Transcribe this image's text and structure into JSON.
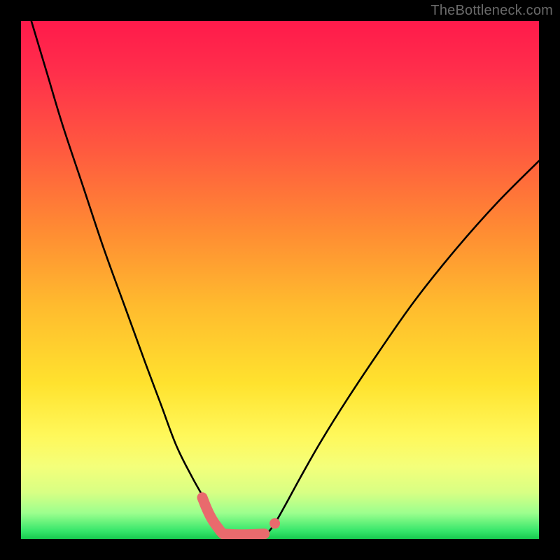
{
  "watermark": "TheBottleneck.com",
  "chart_data": {
    "type": "line",
    "title": "",
    "xlabel": "",
    "ylabel": "",
    "xlim": [
      0,
      100
    ],
    "ylim": [
      0,
      100
    ],
    "series": [
      {
        "name": "curve-left",
        "x": [
          2,
          5,
          8,
          12,
          16,
          20,
          24,
          27,
          30,
          33,
          35.5,
          37,
          38,
          38.8
        ],
        "y": [
          100,
          90,
          80,
          68,
          56,
          45,
          34,
          26,
          18,
          12,
          7.5,
          4.2,
          2.3,
          1.0
        ]
      },
      {
        "name": "curve-right",
        "x": [
          47.5,
          49,
          51,
          54,
          58,
          63,
          69,
          76,
          84,
          92,
          100
        ],
        "y": [
          1.0,
          3.0,
          6.5,
          12,
          19,
          27,
          36,
          46,
          56,
          65,
          73
        ]
      },
      {
        "name": "highlight-left",
        "x": [
          35.0,
          35.8,
          36.5,
          37.2,
          38.0,
          38.6,
          39.0
        ],
        "y": [
          8.0,
          6.0,
          4.5,
          3.3,
          2.2,
          1.4,
          1.0
        ]
      },
      {
        "name": "highlight-bottom",
        "x": [
          39.0,
          40.5,
          42.0,
          43.5,
          45.0,
          46.0,
          47.0
        ],
        "y": [
          1.0,
          0.9,
          0.85,
          0.85,
          0.9,
          0.95,
          1.0
        ]
      },
      {
        "name": "highlight-dot",
        "x": [
          49.0
        ],
        "y": [
          3.0
        ]
      }
    ],
    "gradient_stops": [
      {
        "offset": 0.0,
        "color": "#ff1a4b"
      },
      {
        "offset": 0.1,
        "color": "#ff2f4b"
      },
      {
        "offset": 0.25,
        "color": "#ff5a3f"
      },
      {
        "offset": 0.4,
        "color": "#ff8a33"
      },
      {
        "offset": 0.55,
        "color": "#ffbb2e"
      },
      {
        "offset": 0.7,
        "color": "#ffe22e"
      },
      {
        "offset": 0.8,
        "color": "#fff85a"
      },
      {
        "offset": 0.86,
        "color": "#f4ff7a"
      },
      {
        "offset": 0.91,
        "color": "#d8ff84"
      },
      {
        "offset": 0.95,
        "color": "#9cff8e"
      },
      {
        "offset": 0.985,
        "color": "#35e66a"
      },
      {
        "offset": 1.0,
        "color": "#17c94e"
      }
    ],
    "colors": {
      "curve": "#000000",
      "highlight": "#e96a6d"
    }
  }
}
